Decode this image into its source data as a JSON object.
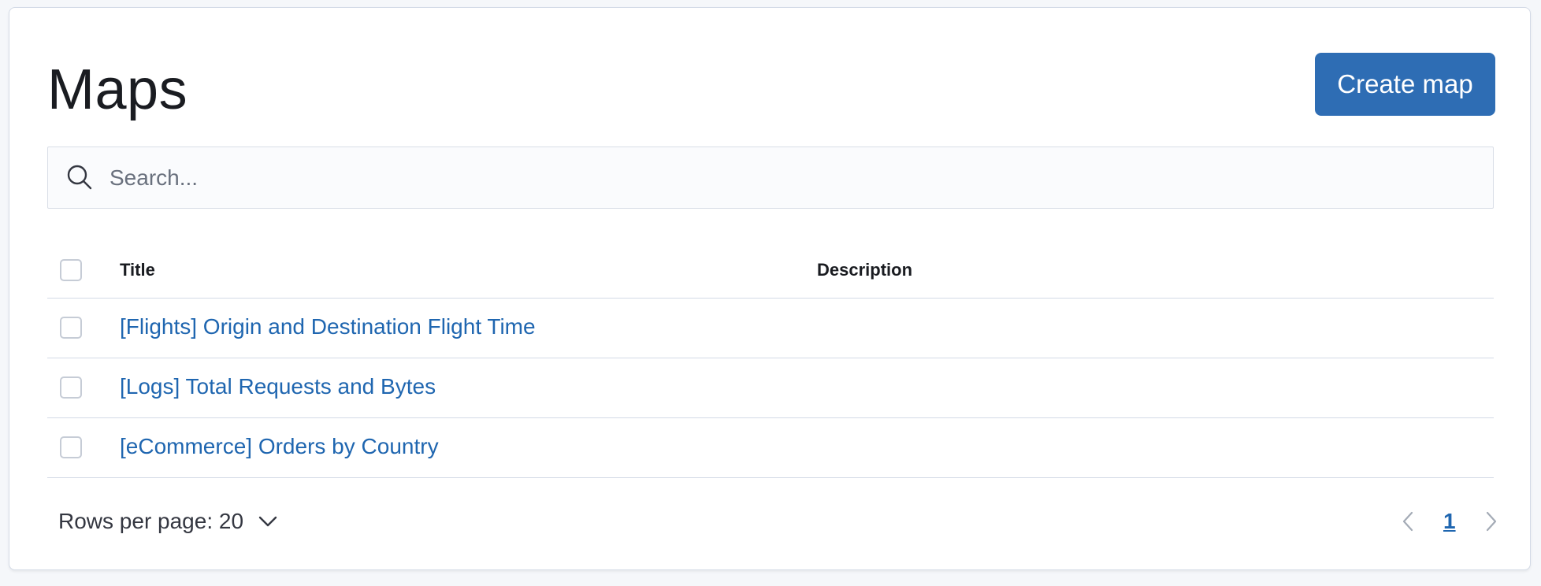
{
  "page": {
    "title": "Maps",
    "create_button_label": "Create map"
  },
  "search": {
    "placeholder": "Search...",
    "value": ""
  },
  "table": {
    "columns": [
      "Title",
      "Description"
    ],
    "rows": [
      {
        "title": "[Flights] Origin and Destination Flight Time",
        "description": ""
      },
      {
        "title": "[Logs] Total Requests and Bytes",
        "description": ""
      },
      {
        "title": "[eCommerce] Orders by Country",
        "description": ""
      }
    ]
  },
  "pagination": {
    "rows_per_page_label": "Rows per page: 20",
    "current_page": "1"
  },
  "colors": {
    "accent": "#2e6db4",
    "link": "#1f66b0",
    "border": "#d3dae6"
  }
}
